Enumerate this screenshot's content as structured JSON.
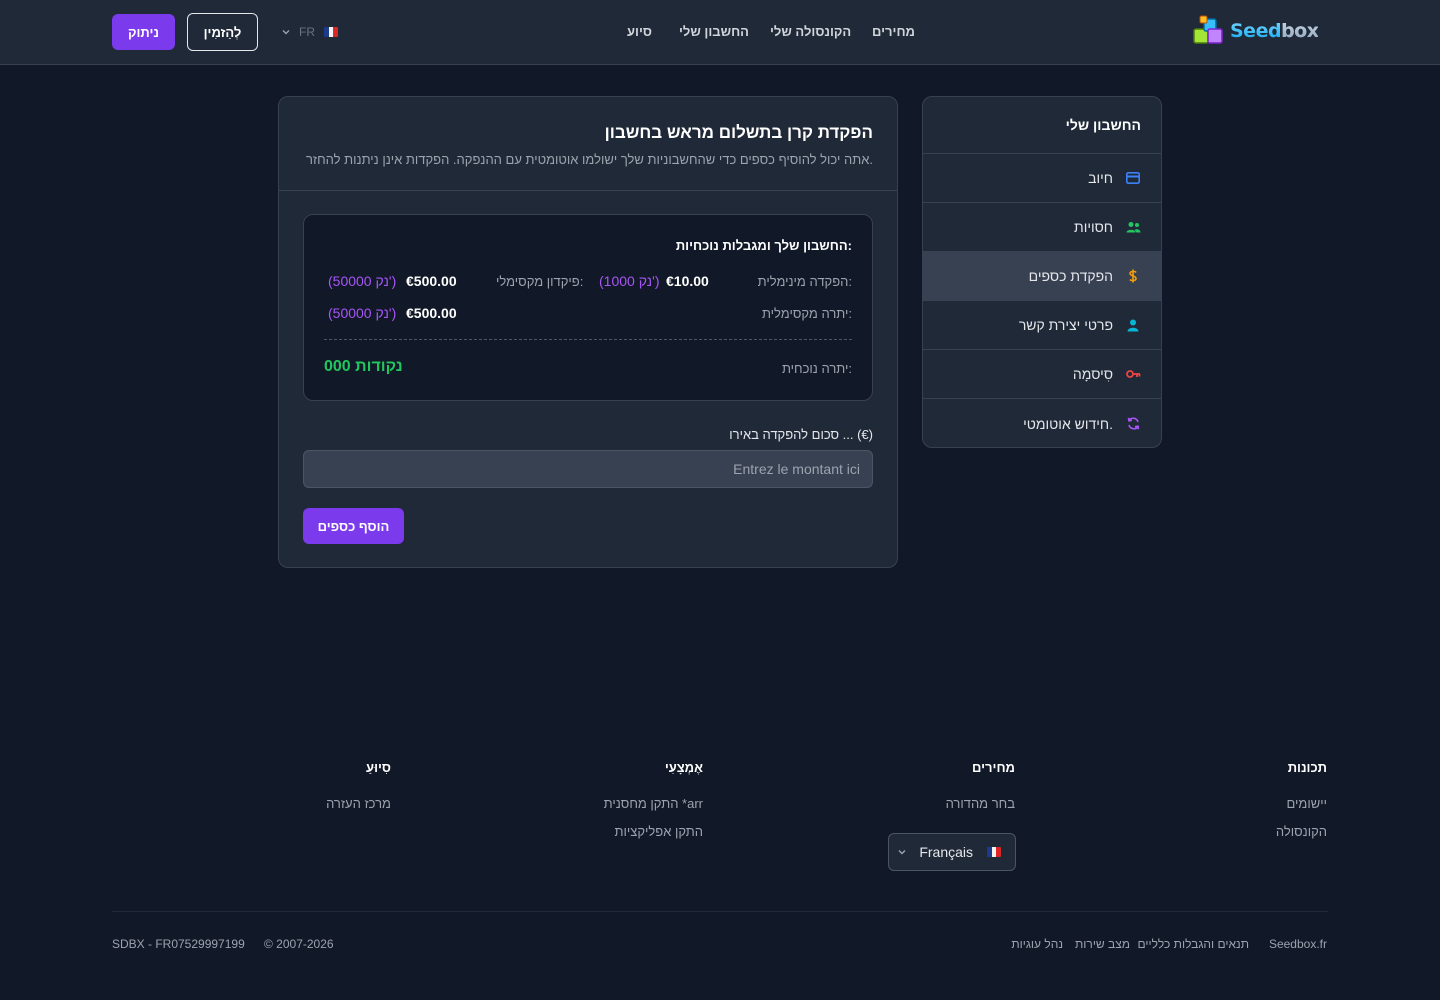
{
  "header": {
    "logo_text_a": "Seed",
    "logo_text_b": "box",
    "nav": [
      "מחירים",
      "הקונסולה שלי",
      "החשבון שלי",
      "סיוע"
    ],
    "lang_code": "FR",
    "invite_label": "לְהַזמִין",
    "logout_label": "ניתוק"
  },
  "sidebar": {
    "title": "החשבון שלי",
    "items": [
      {
        "label": "חיוב",
        "icon": "credit-card-icon",
        "color": "#3b82f6"
      },
      {
        "label": "חסויות",
        "icon": "users-icon",
        "color": "#22c55e"
      },
      {
        "label": "הפקדת כספים",
        "icon": "dollar-icon",
        "color": "#f59e0b"
      },
      {
        "label": "פרטי יצירת קשר",
        "icon": "user-icon",
        "color": "#06b6d4"
      },
      {
        "label": "סִיסמָה",
        "icon": "key-icon",
        "color": "#ef4444"
      },
      {
        "label": "חידוש אוטומטי.",
        "icon": "refresh-icon",
        "color": "#a855f7"
      }
    ]
  },
  "card": {
    "title": "הפקדת קרן בתשלום מראש בחשבון",
    "subtitle": "אתה יכול להוסיף כספים כדי שהחשבוניות שלך ישולמו אוטומטית עם ההנפקה. הפקדות אינן ניתנות להחזר.",
    "limits": {
      "title": "החשבון שלך ומגבלות נוכחיות:",
      "min_deposit_label": "הפקדה מינימלית:",
      "min_deposit_value": "€10.00",
      "min_deposit_points": "(1000 נק')",
      "max_deposit_label": "פיקדון מקסימלי:",
      "max_deposit_value": "€500.00",
      "max_deposit_points": "(50000 נק')",
      "max_balance_label": "יתרה מקסימלית:",
      "max_balance_value": "€500.00",
      "max_balance_points": "(50000 נק')",
      "current_balance_label": "יתרה נוכחית:",
      "current_balance_value": "000 נקודות"
    },
    "amount_label": "סכום להפקדה באירו ... (€)",
    "amount_placeholder": "Entrez le montant ici",
    "amount_value": "",
    "add_button": "הוסף כספים"
  },
  "footer": {
    "columns": [
      {
        "title": "תכונות",
        "links": [
          "יישומים",
          "הקונסולה"
        ]
      },
      {
        "title": "מחירים",
        "links": [
          "בחר מהדורה"
        ]
      },
      {
        "title": "אֶמְצָעִי",
        "links": [
          "התקן מחסנית *arr",
          "התקן אפליקציות"
        ]
      },
      {
        "title": "סִיוּעַ",
        "links": [
          "מרכז העזרה"
        ]
      }
    ],
    "language_selector": "Français",
    "bottom_links": [
      "Seedbox.fr",
      "תנאים והגבלות כלליים",
      "מצב שירות",
      "נהל עוגיות"
    ],
    "copyright": "© 2007-2026",
    "company_id": "SDBX - FR07529997199"
  },
  "colors": {
    "accent": "#7c3aed",
    "positive": "#22c55e",
    "points": "#a855f7"
  }
}
